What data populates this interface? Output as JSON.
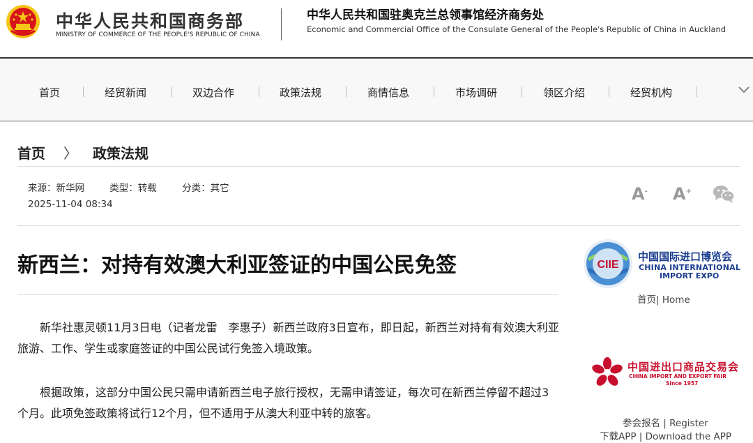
{
  "header": {
    "ministry_cn": "中华人民共和国商务部",
    "ministry_en": "MINISTRY OF COMMERCE OF THE PEOPLE'S REPUBLIC OF CHINA",
    "office_cn": "中华人民共和国驻奥克兰总领事馆经济商务处",
    "office_en": "Economic and Commercial Office of the Consulate General of the People's Republic of China in Auckland",
    "emblem_icon": "national-emblem-icon"
  },
  "nav": {
    "items": [
      "首页",
      "经贸新闻",
      "双边合作",
      "政策法规",
      "商情信息",
      "市场调研",
      "领区介绍",
      "经贸机构"
    ],
    "more_icon": "chevron-down-icon"
  },
  "breadcrumb": {
    "home": "首页",
    "separator": "〉",
    "current": "政策法规"
  },
  "meta": {
    "source": "来源：新华网",
    "type": "类型：转载",
    "category": "分类：其它",
    "date": "2025-11-04 08:34"
  },
  "tools": {
    "font_small": "A",
    "font_small_sign": "-",
    "font_large": "A",
    "font_large_sign": "+",
    "share_icon": "wechat-icon"
  },
  "article": {
    "title": "新西兰：对持有效澳大利亚签证的中国公民免签",
    "paragraphs": [
      "新华社惠灵顿11月3日电（记者龙雷　李惠子）新西兰政府3日宣布，即日起，新西兰对持有有效澳大利亚旅游、工作、学生或家庭签证的中国公民试行免签入境政策。",
      "根据政策，这部分中国公民只需申请新西兰电子旅行授权，无需申请签证，每次可在新西兰停留不超过3个月。此项免签政策将试行12个月，但不适用于从澳大利亚中转的旅客。"
    ]
  },
  "sidebar": {
    "cie": {
      "name_cn": "中国国际进口博览会",
      "name_en_1": "CHINA INTERNATIONAL",
      "name_en_2": "IMPORT EXPO",
      "logo_text": "CIIE",
      "link": "首页| Home"
    },
    "cef": {
      "name_cn": "中国进出口商品交易会",
      "name_en": "CHINA IMPORT AND EXPORT FAIR",
      "since": "Since 1957",
      "register_link": "参会报名 | Register",
      "app_link": "下载APP | Download the APP"
    }
  },
  "colors": {
    "cie_blue": "#1a3d8f",
    "cef_red": "#c8102e",
    "emblem_red": "#d7141a",
    "emblem_gold": "#f5c518"
  }
}
